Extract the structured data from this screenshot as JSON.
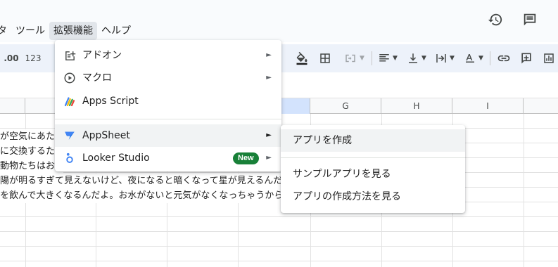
{
  "menubar": {
    "items": [
      "タ",
      "ツール",
      "拡張機能",
      "ヘルプ"
    ],
    "active_index": 2
  },
  "header_icons": [
    "history-icon",
    "comment-icon"
  ],
  "toolbar": {
    "decimal_more_label": ".00",
    "number_format_label": "123"
  },
  "columns": [
    "G",
    "H",
    "I"
  ],
  "cells": [
    "が空気にあたる",
    "に交換するため",
    "動物たちはお",
    "陽が明るすぎて見えないけど、夜になると暗くなって星が見えるんだ",
    "を飲んで大きくなるんだよ。お水がないと元気がなくなっちゃうから"
  ],
  "extensions_menu": {
    "items": [
      {
        "label": "アドオン",
        "icon": "addon-icon",
        "submenu": true
      },
      {
        "label": "マクロ",
        "icon": "macro-play-icon",
        "submenu": true
      },
      {
        "label": "Apps Script",
        "icon": "apps-script-icon",
        "submenu": false
      },
      {
        "label": "AppSheet",
        "icon": "appsheet-icon",
        "submenu": true
      },
      {
        "label": "Looker Studio",
        "icon": "looker-studio-icon",
        "submenu": true,
        "badge": "New"
      }
    ],
    "highlighted_index": 3
  },
  "appsheet_submenu": {
    "items": [
      "アプリを作成",
      "サンプルアプリを見る",
      "アプリの作成方法を見る"
    ],
    "highlighted_index": 0
  },
  "colors": {
    "accent_blue": "#1a73e8",
    "badge_green": "#188038",
    "selected_column": "#d3e3fd",
    "toolbar_bg": "#edf2fa"
  }
}
